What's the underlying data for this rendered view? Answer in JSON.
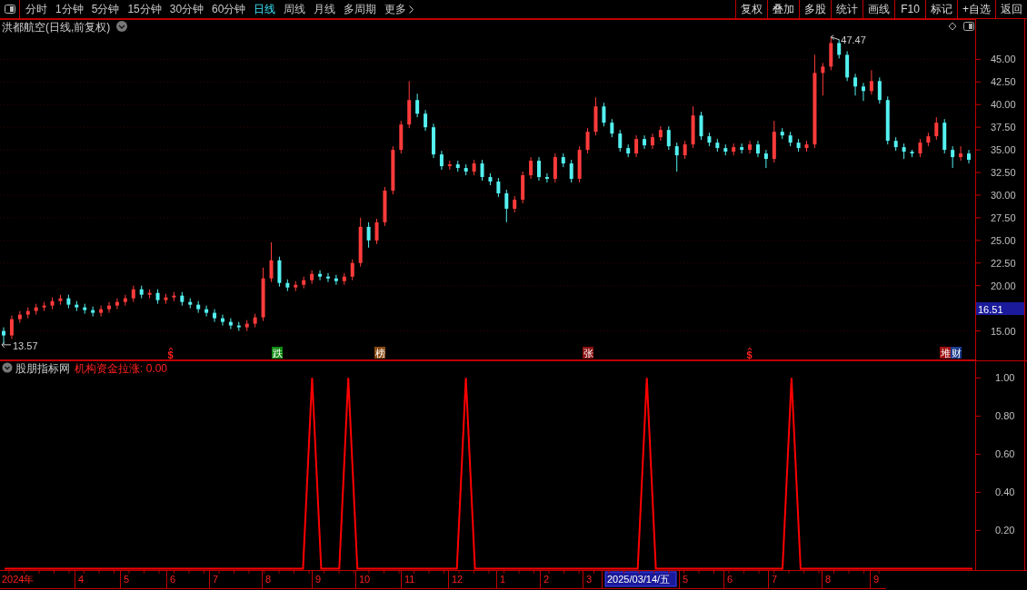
{
  "toolbar": {
    "period_tabs": [
      {
        "label": "分时",
        "selected": false
      },
      {
        "label": "1分钟",
        "selected": false
      },
      {
        "label": "5分钟",
        "selected": false
      },
      {
        "label": "15分钟",
        "selected": false
      },
      {
        "label": "30分钟",
        "selected": false
      },
      {
        "label": "60分钟",
        "selected": false
      },
      {
        "label": "日线",
        "selected": true
      },
      {
        "label": "周线",
        "selected": false
      },
      {
        "label": "月线",
        "selected": false
      },
      {
        "label": "多周期",
        "selected": false
      },
      {
        "label": "更多",
        "selected": false
      }
    ],
    "buttons": [
      "复权",
      "叠加",
      "多股",
      "统计",
      "画线",
      "F10",
      "标记",
      "+自选",
      "返回"
    ]
  },
  "main_chart": {
    "title": "洪都航空(日线,前复权)",
    "high_label": "47.47",
    "low_label": "13.57",
    "last_price": "16.51",
    "chart_data": {
      "type": "candlestick",
      "grid": true,
      "ylim": [
        11.8,
        49.4
      ],
      "yticks": [
        {
          "value": 45,
          "label": "45.00"
        },
        {
          "value": 42.5,
          "label": "42.50"
        },
        {
          "value": 40,
          "label": "40.00"
        },
        {
          "value": 37.5,
          "label": "37.50"
        },
        {
          "value": 35,
          "label": "35.00"
        },
        {
          "value": 32.5,
          "label": "32.50"
        },
        {
          "value": 30,
          "label": "30.00"
        },
        {
          "value": 27.5,
          "label": "27.50"
        },
        {
          "value": 25,
          "label": "25.00"
        },
        {
          "value": 22.5,
          "label": "22.50"
        },
        {
          "value": 20,
          "label": "20.00"
        },
        {
          "value": 15,
          "label": "15.00"
        }
      ],
      "ohlc": [
        [
          15.0,
          15.4,
          13.57,
          14.5
        ],
        [
          14.5,
          16.7,
          14.1,
          16.3
        ],
        [
          16.3,
          17.2,
          15.9,
          16.8
        ],
        [
          16.8,
          17.6,
          16.4,
          17.2
        ],
        [
          17.2,
          18.0,
          16.8,
          17.6
        ],
        [
          17.6,
          18.2,
          17.2,
          17.8
        ],
        [
          17.8,
          18.7,
          17.4,
          18.3
        ],
        [
          18.3,
          19.0,
          17.9,
          18.6
        ],
        [
          18.6,
          19.0,
          17.5,
          17.9
        ],
        [
          17.9,
          18.3,
          17.2,
          17.6
        ],
        [
          17.6,
          18.0,
          16.9,
          17.3
        ],
        [
          17.3,
          17.7,
          16.6,
          17.0
        ],
        [
          17.0,
          17.8,
          16.6,
          17.4
        ],
        [
          17.4,
          18.2,
          17.0,
          17.8
        ],
        [
          17.8,
          18.6,
          17.4,
          18.2
        ],
        [
          18.2,
          19.0,
          17.8,
          18.6
        ],
        [
          18.6,
          20.0,
          18.2,
          19.6
        ],
        [
          19.6,
          20.0,
          18.6,
          19.0
        ],
        [
          19.0,
          19.6,
          18.6,
          19.2
        ],
        [
          19.2,
          19.6,
          18.0,
          18.4
        ],
        [
          18.4,
          19.1,
          18.0,
          18.7
        ],
        [
          18.7,
          19.3,
          18.3,
          18.9
        ],
        [
          18.9,
          19.3,
          17.8,
          18.2
        ],
        [
          18.2,
          18.6,
          17.5,
          17.9
        ],
        [
          17.9,
          18.3,
          17.0,
          17.4
        ],
        [
          17.4,
          17.8,
          16.6,
          17.0
        ],
        [
          17.0,
          17.4,
          16.0,
          16.4
        ],
        [
          16.4,
          16.8,
          15.6,
          16.0
        ],
        [
          16.0,
          16.4,
          15.2,
          15.6
        ],
        [
          15.6,
          16.0,
          15.0,
          15.4
        ],
        [
          15.4,
          16.2,
          15.0,
          15.8
        ],
        [
          15.8,
          16.9,
          15.4,
          16.5
        ],
        [
          16.5,
          22.0,
          16.1,
          20.8
        ],
        [
          20.8,
          24.8,
          20.4,
          22.8
        ],
        [
          22.8,
          23.2,
          19.9,
          20.3
        ],
        [
          20.3,
          20.7,
          19.4,
          19.8
        ],
        [
          19.8,
          20.5,
          19.4,
          20.1
        ],
        [
          20.1,
          21.0,
          19.7,
          20.6
        ],
        [
          20.6,
          21.7,
          20.2,
          21.3
        ],
        [
          21.3,
          21.7,
          20.6,
          21.0
        ],
        [
          21.0,
          21.4,
          20.4,
          20.8
        ],
        [
          20.8,
          21.2,
          20.1,
          20.5
        ],
        [
          20.5,
          21.4,
          20.1,
          21.0
        ],
        [
          21.0,
          22.9,
          20.6,
          22.5
        ],
        [
          22.5,
          27.5,
          22.1,
          26.5
        ],
        [
          26.5,
          27.0,
          24.2,
          25.0
        ],
        [
          25.0,
          27.4,
          24.6,
          27.0
        ],
        [
          27.0,
          30.9,
          26.6,
          30.5
        ],
        [
          30.5,
          35.4,
          30.1,
          35.0
        ],
        [
          35.0,
          38.2,
          34.6,
          37.8
        ],
        [
          37.8,
          42.6,
          37.4,
          40.5
        ],
        [
          40.5,
          41.2,
          38.6,
          39.0
        ],
        [
          39.0,
          39.4,
          37.1,
          37.5
        ],
        [
          37.5,
          37.9,
          34.1,
          34.5
        ],
        [
          34.5,
          34.9,
          32.8,
          33.2
        ],
        [
          33.2,
          33.8,
          32.8,
          33.4
        ],
        [
          33.4,
          33.8,
          32.6,
          33.0
        ],
        [
          33.0,
          33.4,
          32.2,
          32.6
        ],
        [
          32.6,
          33.9,
          32.2,
          33.5
        ],
        [
          33.5,
          33.9,
          31.6,
          32.0
        ],
        [
          32.0,
          32.4,
          31.1,
          31.5
        ],
        [
          31.5,
          31.9,
          29.8,
          30.2
        ],
        [
          30.2,
          30.6,
          27.0,
          28.5
        ],
        [
          28.5,
          29.9,
          28.1,
          29.5
        ],
        [
          29.5,
          32.6,
          29.1,
          32.2
        ],
        [
          32.2,
          34.2,
          31.8,
          33.8
        ],
        [
          33.8,
          34.2,
          31.6,
          32.0
        ],
        [
          32.0,
          32.4,
          31.4,
          31.8
        ],
        [
          31.8,
          34.6,
          31.4,
          34.2
        ],
        [
          34.2,
          34.6,
          33.1,
          33.5
        ],
        [
          33.5,
          33.9,
          31.4,
          31.8
        ],
        [
          31.8,
          35.4,
          31.4,
          35.0
        ],
        [
          35.0,
          37.4,
          34.6,
          37.0
        ],
        [
          37.0,
          40.8,
          36.6,
          39.8
        ],
        [
          39.8,
          40.2,
          37.6,
          38.0
        ],
        [
          38.0,
          38.4,
          36.4,
          36.8
        ],
        [
          36.8,
          37.2,
          34.8,
          35.2
        ],
        [
          35.2,
          35.6,
          34.2,
          34.6
        ],
        [
          34.6,
          36.6,
          34.2,
          36.2
        ],
        [
          36.2,
          36.6,
          35.1,
          35.5
        ],
        [
          35.5,
          36.8,
          35.1,
          36.4
        ],
        [
          36.4,
          37.6,
          36.0,
          37.2
        ],
        [
          37.2,
          37.6,
          35.0,
          35.4
        ],
        [
          35.4,
          35.8,
          32.6,
          34.4
        ],
        [
          34.4,
          36.0,
          34.0,
          35.6
        ],
        [
          35.6,
          39.8,
          35.2,
          38.8
        ],
        [
          38.8,
          39.2,
          36.1,
          36.5
        ],
        [
          36.5,
          36.9,
          35.4,
          35.8
        ],
        [
          35.8,
          36.2,
          34.8,
          35.2
        ],
        [
          35.2,
          35.6,
          34.4,
          34.8
        ],
        [
          34.8,
          35.7,
          34.4,
          35.3
        ],
        [
          35.3,
          35.7,
          34.6,
          35.0
        ],
        [
          35.0,
          36.0,
          34.6,
          35.6
        ],
        [
          35.6,
          36.0,
          34.2,
          34.6
        ],
        [
          34.6,
          35.0,
          33.0,
          34.0
        ],
        [
          34.0,
          38.2,
          33.6,
          37.0
        ],
        [
          37.0,
          37.4,
          36.2,
          36.6
        ],
        [
          36.6,
          37.0,
          35.4,
          35.8
        ],
        [
          35.8,
          36.2,
          34.8,
          35.2
        ],
        [
          35.2,
          36.0,
          34.8,
          35.6
        ],
        [
          35.6,
          45.5,
          35.2,
          43.5
        ],
        [
          43.5,
          44.6,
          41.0,
          44.2
        ],
        [
          44.2,
          47.47,
          43.8,
          46.8
        ],
        [
          46.8,
          47.2,
          45.1,
          45.5
        ],
        [
          45.5,
          45.9,
          42.6,
          43.0
        ],
        [
          43.0,
          43.4,
          41.0,
          42.0
        ],
        [
          42.0,
          42.4,
          40.4,
          41.5
        ],
        [
          41.5,
          43.8,
          41.1,
          42.6
        ],
        [
          42.6,
          43.0,
          40.1,
          40.5
        ],
        [
          40.5,
          40.9,
          35.6,
          36.0
        ],
        [
          36.0,
          36.4,
          34.9,
          35.3
        ],
        [
          35.3,
          35.7,
          34.0,
          34.8
        ],
        [
          34.8,
          35.0,
          34.2,
          34.6
        ],
        [
          34.6,
          36.2,
          34.2,
          35.8
        ],
        [
          35.8,
          36.9,
          35.4,
          36.5
        ],
        [
          36.5,
          38.6,
          36.1,
          38.0
        ],
        [
          38.0,
          38.4,
          34.6,
          35.0
        ],
        [
          35.0,
          35.4,
          33.0,
          34.2
        ],
        [
          34.2,
          35.4,
          33.8,
          34.6
        ],
        [
          34.6,
          35.0,
          33.5,
          33.9
        ]
      ]
    },
    "signals": [
      {
        "kind": "dollar",
        "text": "$"
      },
      {
        "kind": "badge",
        "text": "跌",
        "color": "#0f8a12"
      },
      {
        "kind": "badge",
        "text": "榜",
        "color": "#8a4a12"
      },
      {
        "kind": "badge",
        "text": "张",
        "color": "#8a1010"
      },
      {
        "kind": "dollar",
        "text": "$"
      },
      {
        "kind": "badge",
        "text": "堆",
        "color": "#a01010"
      },
      {
        "kind": "badge",
        "text": "财",
        "color": "#1a3a8a"
      }
    ]
  },
  "indicator": {
    "source": "股朋指标网",
    "label": "机构资金拉涨: 0.00",
    "chart_data": {
      "type": "line",
      "ylim": [
        -0.01,
        1.09
      ],
      "categories": [
        null,
        null,
        null,
        null,
        null,
        null,
        null,
        null,
        null,
        null,
        null,
        null,
        null,
        null,
        null,
        null,
        null,
        null,
        null,
        null,
        null,
        null,
        null,
        null,
        null,
        null,
        null,
        null,
        null,
        null,
        null,
        null,
        null,
        null,
        null,
        null,
        null,
        null,
        null,
        null,
        null,
        null,
        null,
        null,
        null,
        null,
        null,
        null,
        null,
        null,
        null,
        null,
        null,
        null,
        null,
        null,
        null,
        null,
        null,
        null,
        null,
        null,
        null,
        null,
        null,
        null,
        null,
        null,
        null,
        null,
        null,
        null,
        null,
        null,
        null,
        null,
        null,
        null,
        null,
        null,
        null,
        null,
        null,
        null,
        null,
        null,
        null,
        null,
        null,
        null,
        null,
        null,
        null,
        null,
        null,
        null,
        null,
        null,
        null,
        null,
        null,
        null,
        null,
        null,
        null,
        null,
        null,
        null
      ],
      "series": [
        {
          "color": "#ff0000",
          "values": [
            0,
            0,
            0,
            0,
            0,
            0,
            0,
            0,
            0,
            0,
            0,
            0,
            0,
            0,
            0,
            0,
            0,
            0,
            0,
            0,
            0,
            0,
            0,
            0,
            0,
            0,
            0,
            0,
            0,
            0,
            0,
            0,
            0,
            0,
            1,
            0,
            0,
            0,
            1,
            0,
            0,
            0,
            0,
            0,
            0,
            0,
            0,
            0,
            0,
            0,
            0,
            1,
            0,
            0,
            0,
            0,
            0,
            0,
            0,
            0,
            0,
            0,
            0,
            0,
            0,
            0,
            0,
            0,
            0,
            0,
            0,
            1,
            0,
            0,
            0,
            0,
            0,
            0,
            0,
            0,
            0,
            0,
            0,
            0,
            0,
            0,
            0,
            1,
            0,
            0,
            0,
            0,
            0,
            0,
            0,
            0,
            0,
            0,
            0,
            0,
            0,
            0,
            0,
            0,
            0,
            0,
            0,
            0
          ]
        }
      ],
      "yticks": [
        {
          "value": 0.2,
          "label": "0.20"
        },
        {
          "value": 0.4,
          "label": "0.40"
        },
        {
          "value": 0.6,
          "label": "0.60"
        },
        {
          "value": 0.8,
          "label": "0.80"
        },
        {
          "value": 1,
          "label": "1.00"
        }
      ]
    }
  },
  "date_axis": [
    {
      "label": "2024年",
      "highlighted": false
    },
    {
      "label": "4",
      "highlighted": false
    },
    {
      "label": "5",
      "highlighted": false
    },
    {
      "label": "6",
      "highlighted": false
    },
    {
      "label": "7",
      "highlighted": false
    },
    {
      "label": "8",
      "highlighted": false
    },
    {
      "label": "9",
      "highlighted": false
    },
    {
      "label": "10",
      "highlighted": false
    },
    {
      "label": "11",
      "highlighted": false
    },
    {
      "label": "12",
      "highlighted": false
    },
    {
      "label": "1",
      "highlighted": false
    },
    {
      "label": "2",
      "highlighted": false
    },
    {
      "label": "3",
      "highlighted": false
    },
    {
      "label": "2025/03/14/五",
      "highlighted": true
    },
    {
      "label": "5",
      "highlighted": false
    },
    {
      "label": "6",
      "highlighted": false
    },
    {
      "label": "7",
      "highlighted": false
    },
    {
      "label": "8",
      "highlighted": false
    },
    {
      "label": "9",
      "highlighted": false
    }
  ]
}
